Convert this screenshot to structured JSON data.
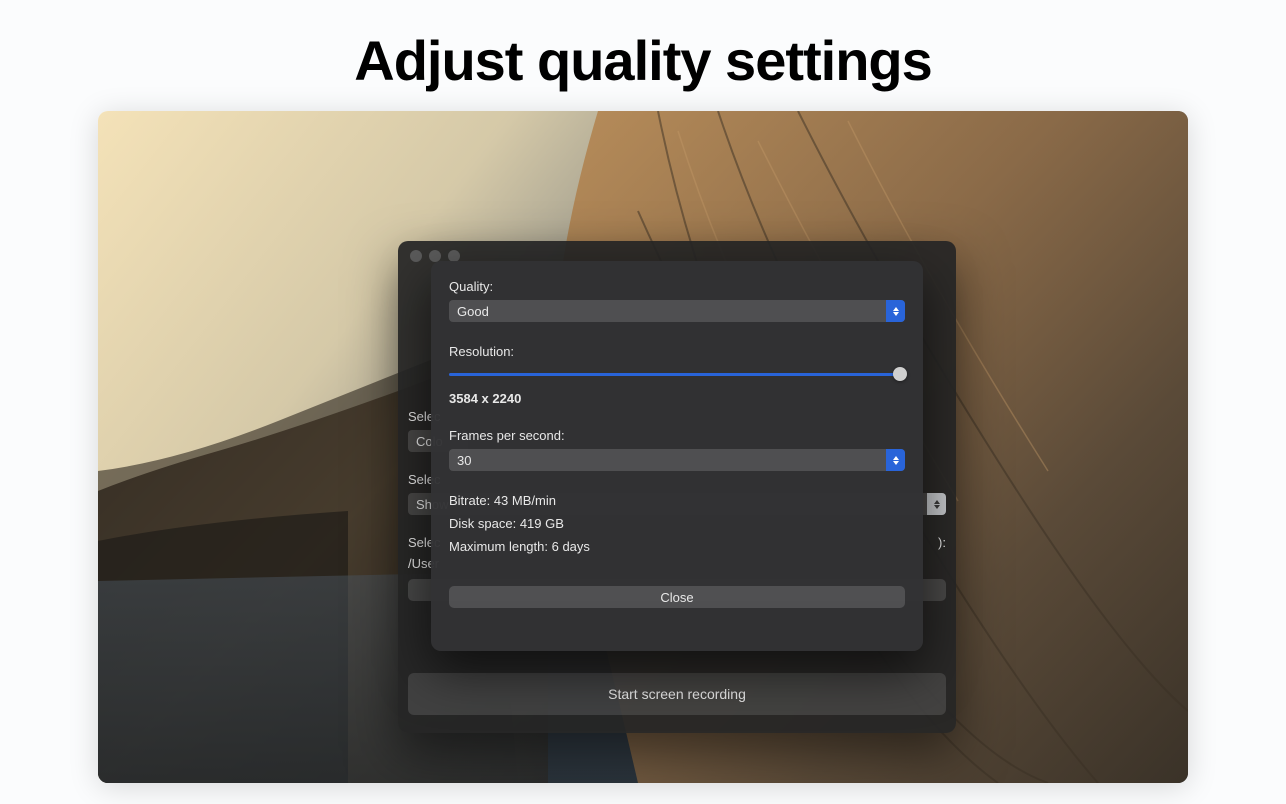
{
  "page_heading": "Adjust quality settings",
  "back_window": {
    "select_color_label": "Selec",
    "select_color_value": "Colo",
    "select_show_label": "Selec",
    "select_show_value": "Show",
    "select_dest_label": "Selec",
    "select_dest_suffix": "):",
    "path": "/User",
    "start_button": "Start screen recording"
  },
  "front_window": {
    "quality_label": "Quality:",
    "quality_value": "Good",
    "resolution_label": "Resolution:",
    "resolution_value": "3584 x 2240",
    "fps_label": "Frames per second:",
    "fps_value": "30",
    "bitrate_label": "Bitrate:",
    "bitrate_value": "43 MB/min",
    "disk_label": "Disk space:",
    "disk_value": "419 GB",
    "maxlen_label": "Maximum length:",
    "maxlen_value": "6 days",
    "close_button": "Close"
  }
}
